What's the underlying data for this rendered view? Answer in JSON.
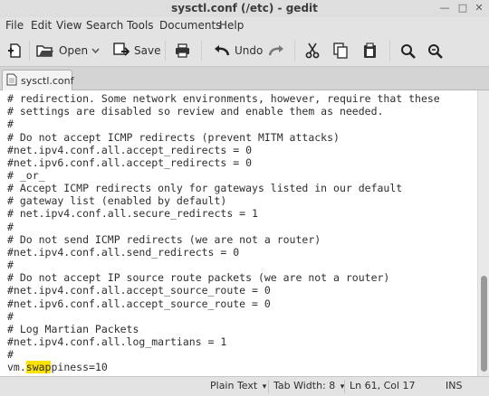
{
  "window": {
    "title": "sysctl.conf (/etc) - gedit"
  },
  "menu": {
    "file": "File",
    "edit": "Edit",
    "view": "View",
    "search": "Search",
    "tools": "Tools",
    "documents": "Documents",
    "help": "Help"
  },
  "toolbar": {
    "open_label": "Open",
    "save_label": "Save",
    "undo_label": "Undo"
  },
  "tab": {
    "label": "sysctl.conf"
  },
  "editor": {
    "lines": [
      "# redirection. Some network environments, however, require that these",
      "# settings are disabled so review and enable them as needed.",
      "#",
      "# Do not accept ICMP redirects (prevent MITM attacks)",
      "#net.ipv4.conf.all.accept_redirects = 0",
      "#net.ipv6.conf.all.accept_redirects = 0",
      "# _or_",
      "# Accept ICMP redirects only for gateways listed in our default",
      "# gateway list (enabled by default)",
      "# net.ipv4.conf.all.secure_redirects = 1",
      "#",
      "# Do not send ICMP redirects (we are not a router)",
      "#net.ipv4.conf.all.send_redirects = 0",
      "#",
      "# Do not accept IP source route packets (we are not a router)",
      "#net.ipv4.conf.all.accept_source_route = 0",
      "#net.ipv6.conf.all.accept_source_route = 0",
      "#",
      "# Log Martian Packets",
      "#net.ipv4.conf.all.log_martians = 1",
      "#"
    ],
    "last_line": {
      "prefix": "vm.",
      "highlight": "swap",
      "suffix": "piness=10"
    },
    "highlight_color": "#fbe200"
  },
  "status": {
    "language": "Plain Text",
    "tab_width": "Tab Width: 8",
    "position": "Ln 61, Col 17",
    "mode": "INS"
  }
}
